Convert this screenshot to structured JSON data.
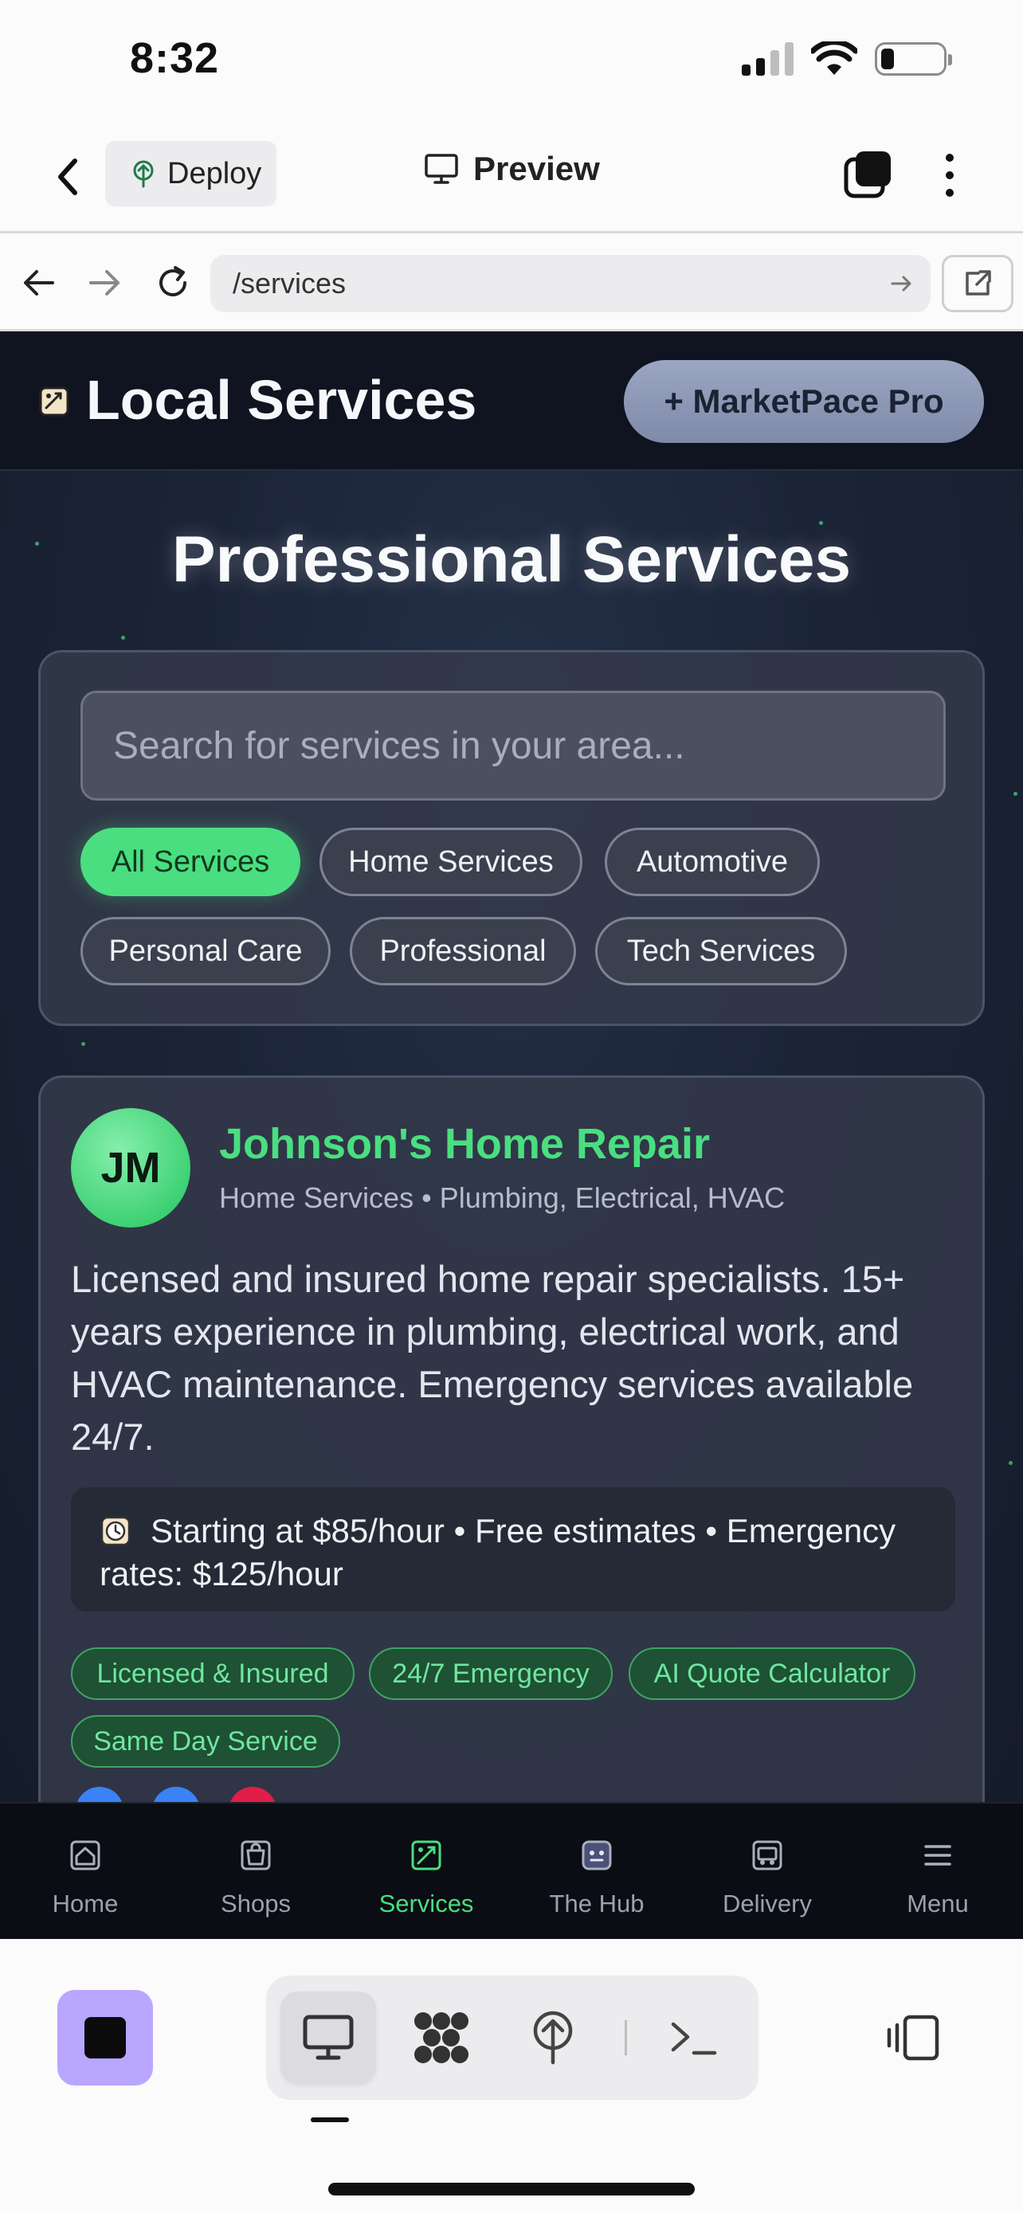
{
  "status_bar": {
    "time": "8:32"
  },
  "app_header": {
    "deploy_label": "Deploy",
    "preview_label": "Preview"
  },
  "url_bar": {
    "url": "/services"
  },
  "site": {
    "title": "Local Services",
    "pro_button": "+ MarketPace Pro",
    "hero_title": "Professional Services",
    "search_placeholder": "Search for services in your area...",
    "filters": [
      "All Services",
      "Home Services",
      "Automotive",
      "Personal Care",
      "Professional",
      "Tech Services"
    ],
    "active_filter": "All Services",
    "listing": {
      "initials": "JM",
      "name": "Johnson's Home Repair",
      "category": "Home Services • Plumbing, Electrical, HVAC",
      "description": "Licensed and insured home repair specialists. 15+ years experience in plumbing, electrical work, and HVAC maintenance. Emergency services available 24/7.",
      "pricing": "Starting at $85/hour • Free estimates • Emergency rates: $125/hour",
      "tags": [
        "Licensed & Insured",
        "24/7 Emergency",
        "AI Quote Calculator",
        "Same Day Service"
      ]
    },
    "bottom_nav": [
      "Home",
      "Shops",
      "Services",
      "The Hub",
      "Delivery",
      "Menu"
    ],
    "active_nav": "Services"
  },
  "colors": {
    "accent": "#4ade80",
    "dark_bg": "#1a2234",
    "stop_button": "#b9a6ff"
  }
}
